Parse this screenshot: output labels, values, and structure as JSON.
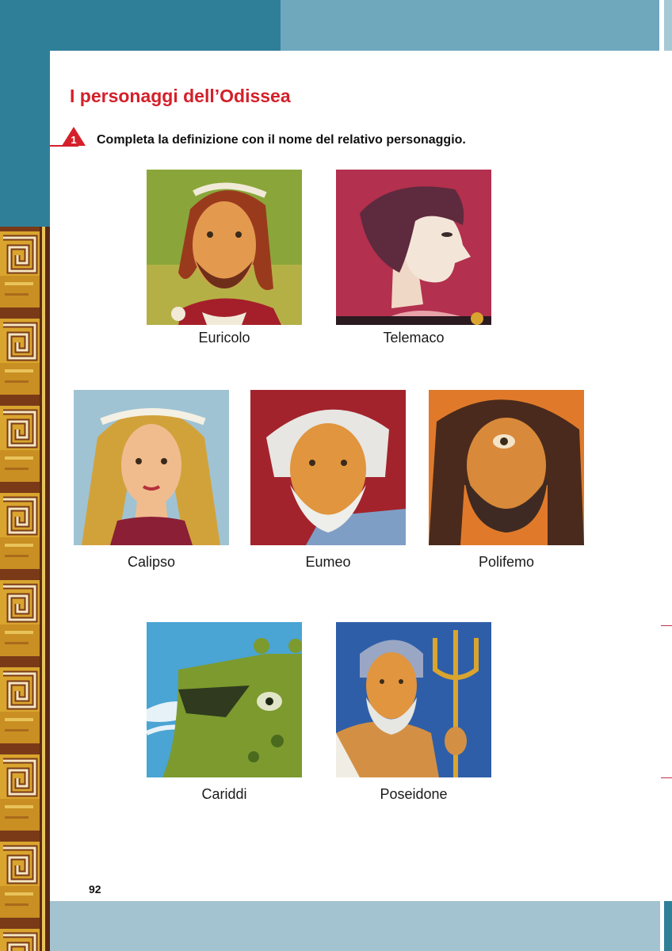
{
  "page": {
    "title": "I personaggi dell’Odissea",
    "number": "92"
  },
  "exercise": {
    "number": "1",
    "instruction": "Completa la definizione con il nome del relativo personaggio."
  },
  "characters": [
    {
      "name": "Euricolo"
    },
    {
      "name": "Telemaco"
    },
    {
      "name": "Calipso"
    },
    {
      "name": "Eumeo"
    },
    {
      "name": "Polifemo"
    },
    {
      "name": "Cariddi"
    },
    {
      "name": "Poseidone"
    }
  ],
  "colors": {
    "title_red": "#d4202a",
    "frame_teal": "#2f7f99",
    "frame_light_blue": "#6fa8bd",
    "bottom_band": "#a3c3d0",
    "greek_gold": "#d9a52e"
  }
}
